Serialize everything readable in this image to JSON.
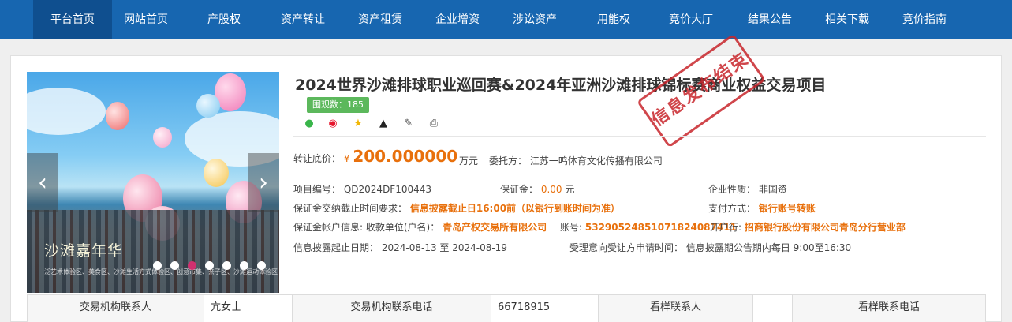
{
  "nav": {
    "items": [
      "平台首页",
      "网站首页",
      "产股权",
      "资产转让",
      "资产租赁",
      "企业增资",
      "涉讼资产",
      "用能权",
      "竞价大厅",
      "结果公告",
      "相关下载",
      "竞价指南"
    ]
  },
  "carousel": {
    "caption": "沙滩嘉年华",
    "subcaption": "泛艺术体验区、美食区、沙滩生活方式体验区、创意市集、亲子区、沙滩运动体验区",
    "prev_icon": "chevron-left-icon",
    "next_icon": "chevron-right-icon",
    "dot_count": 7,
    "active_dot": 3
  },
  "project": {
    "title": "2024世界沙滩排球职业巡回赛&2024年亚洲沙滩排球锦标赛商业权益交易项目",
    "views": "围观数：185",
    "stamp": "信息发布结束",
    "share_icons": [
      "wechat-icon",
      "weibo-icon",
      "favorite-star-icon",
      "qq-icon",
      "edit-icon",
      "print-icon"
    ]
  },
  "price": {
    "label": "转让底价：",
    "currency": "¥",
    "value": "200.000000",
    "unit": "万元",
    "entrust_label": "委托方：",
    "entrust_value": "江苏一鸣体育文化传播有限公司"
  },
  "details": {
    "project_no_label": "项目编号：",
    "project_no": "QD2024DF100443",
    "deposit_label": "保证金：",
    "deposit_value": "0.00",
    "deposit_unit": "元",
    "nature_label": "企业性质：",
    "nature_value": "非国资",
    "deadline_label": "保证金交纳截止时间要求：",
    "deadline_value": "信息披露截止日16:00前（以银行到账时间为准）",
    "pay_label": "支付方式：",
    "pay_value": "银行账号转账",
    "account_label": "保证金帐户信息: 收款单位(户名)：",
    "account_name": "青岛产权交易所有限公司",
    "account_no_label": "账号:",
    "account_no": "532905248510718240874​11",
    "bank_label": "开户行:",
    "bank_value": "招商银行股份有限公司青岛分行营业部",
    "disclose_label": "信息披露起止日期：",
    "disclose_value": "2024-08-13 至 2024-08-19",
    "accept_label": "受理意向受让方申请时间：",
    "accept_value": "信息披露期公告期内每日 9:00至16:30"
  },
  "contacts": {
    "org_contact_label": "交易机构联系人",
    "org_contact_value": "亢女士",
    "org_phone_label": "交易机构联系电话",
    "org_phone_value": "66718915",
    "view_contact_label": "看样联系人",
    "view_contact_value": "",
    "view_phone_label": "看样联系电话"
  }
}
